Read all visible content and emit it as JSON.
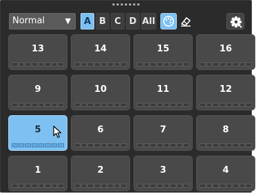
{
  "toolbar": {
    "mode": "Normal",
    "banks": [
      {
        "label": "A",
        "active": true
      },
      {
        "label": "B",
        "active": false
      },
      {
        "label": "C",
        "active": false
      },
      {
        "label": "D",
        "active": false
      },
      {
        "label": "All",
        "active": false
      }
    ]
  },
  "pads": [
    {
      "label": "13"
    },
    {
      "label": "14"
    },
    {
      "label": "15"
    },
    {
      "label": "16"
    },
    {
      "label": "9"
    },
    {
      "label": "10"
    },
    {
      "label": "11"
    },
    {
      "label": "12"
    },
    {
      "label": "5"
    },
    {
      "label": "6"
    },
    {
      "label": "7"
    },
    {
      "label": "8"
    },
    {
      "label": "1"
    },
    {
      "label": "2"
    },
    {
      "label": "3"
    },
    {
      "label": "4"
    }
  ],
  "selected_pad": "5",
  "colors": {
    "accent": "#7cc0f2",
    "panel_bg": "#2b2b2b",
    "pad_bg": "#494949"
  },
  "icons": {
    "grip": "drag-handle-icon",
    "palette": "palette-icon",
    "eraser": "eraser-icon",
    "gear": "gear-icon",
    "cursor": "mouse-pointer-icon"
  }
}
